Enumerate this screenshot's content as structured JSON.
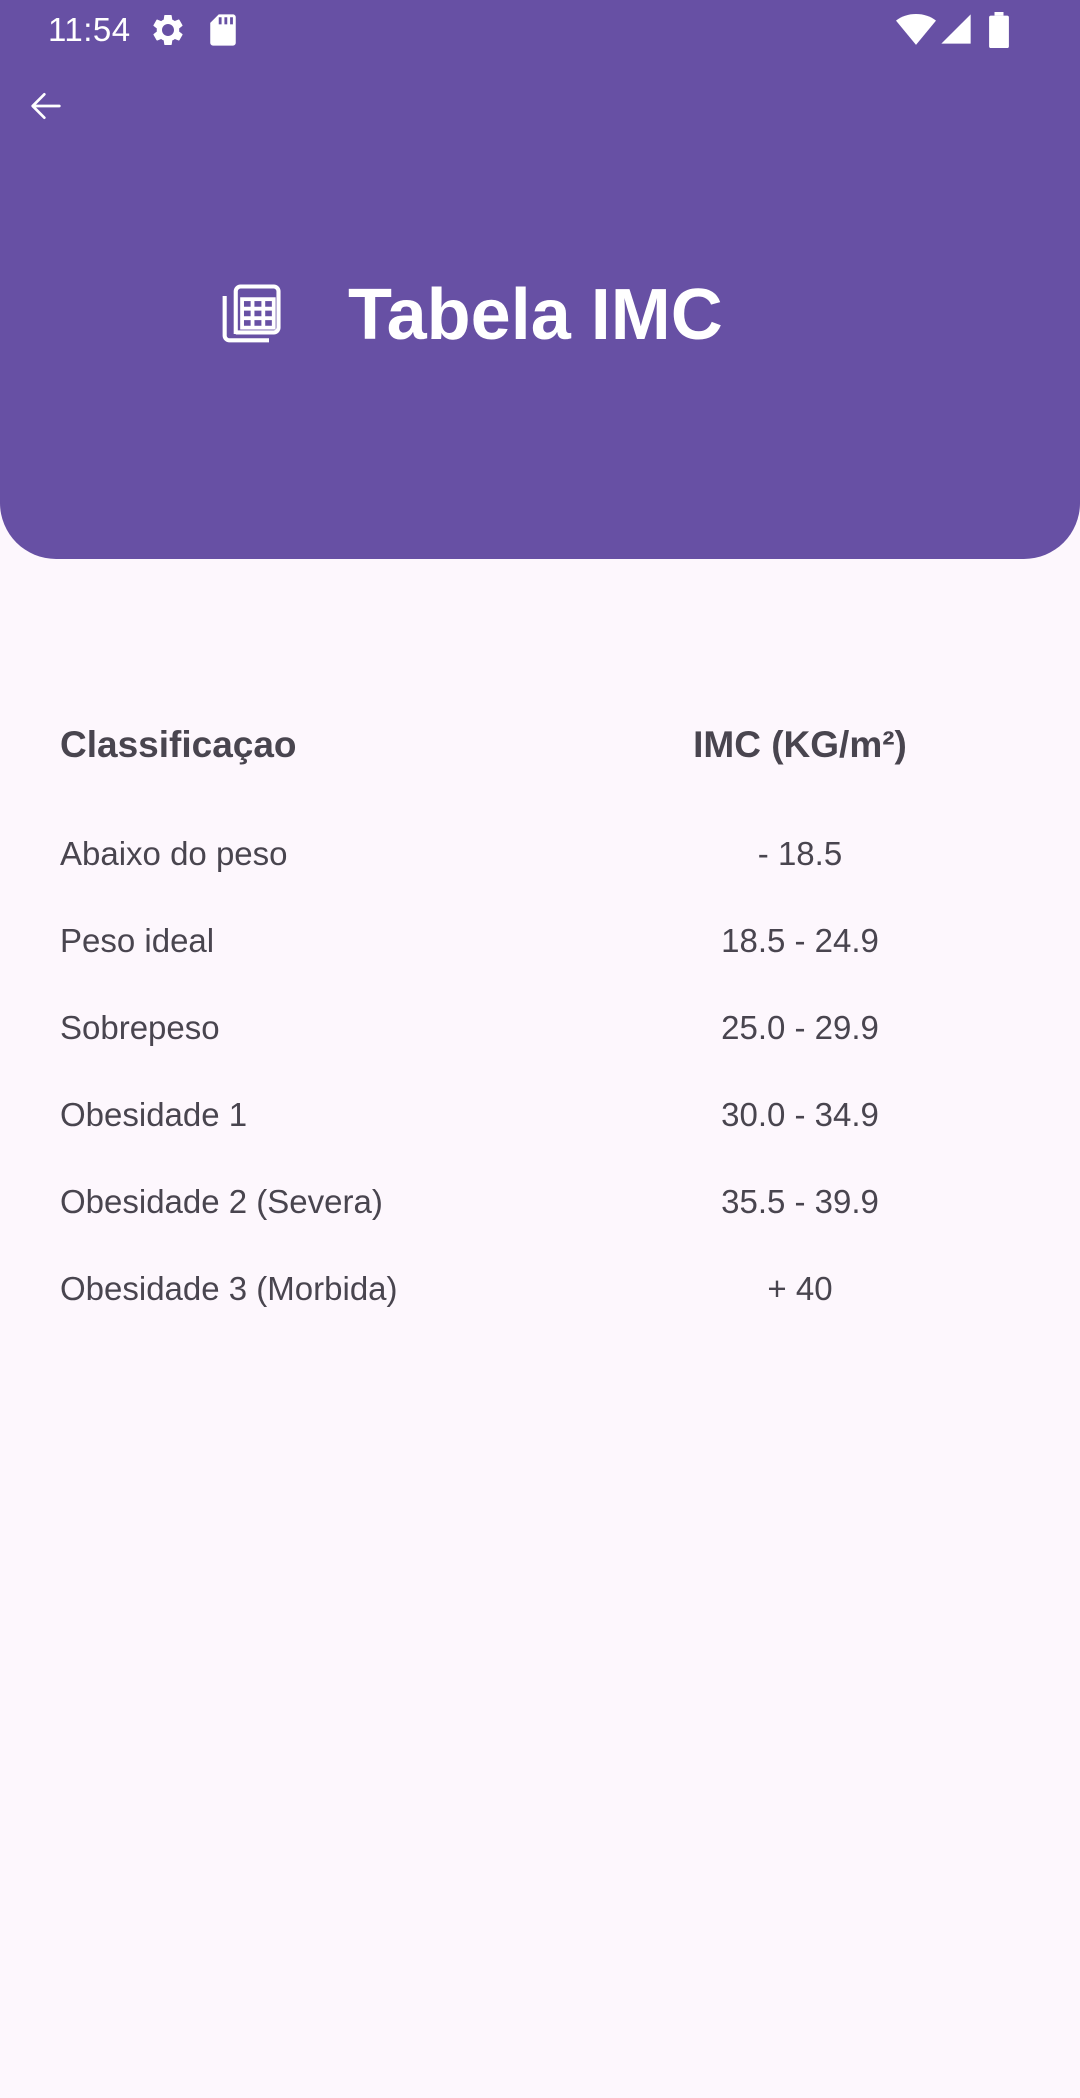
{
  "status_bar": {
    "time": "11:54",
    "icons": [
      "settings-gear-icon",
      "sd-card-icon",
      "wifi-icon",
      "cell-signal-icon",
      "battery-icon"
    ]
  },
  "colors": {
    "header_bg": "#6750a4",
    "page_bg": "#fdf7fd",
    "text": "#49454f",
    "on_header": "#ffffff"
  },
  "header": {
    "back_icon": "arrow-back-icon",
    "title_icon": "table-icon",
    "title": "Tabela IMC"
  },
  "table": {
    "headers": {
      "classification": "Classificaçao",
      "imc": "IMC (KG/m²)"
    },
    "rows": [
      {
        "classification": "Abaixo do peso",
        "imc": "- 18.5"
      },
      {
        "classification": "Peso ideal",
        "imc": "18.5 - 24.9"
      },
      {
        "classification": "Sobrepeso",
        "imc": "25.0 - 29.9"
      },
      {
        "classification": "Obesidade 1",
        "imc": "30.0 - 34.9"
      },
      {
        "classification": "Obesidade 2 (Severa)",
        "imc": "35.5 - 39.9"
      },
      {
        "classification": "Obesidade 3 (Morbida)",
        "imc": "+ 40"
      }
    ]
  }
}
